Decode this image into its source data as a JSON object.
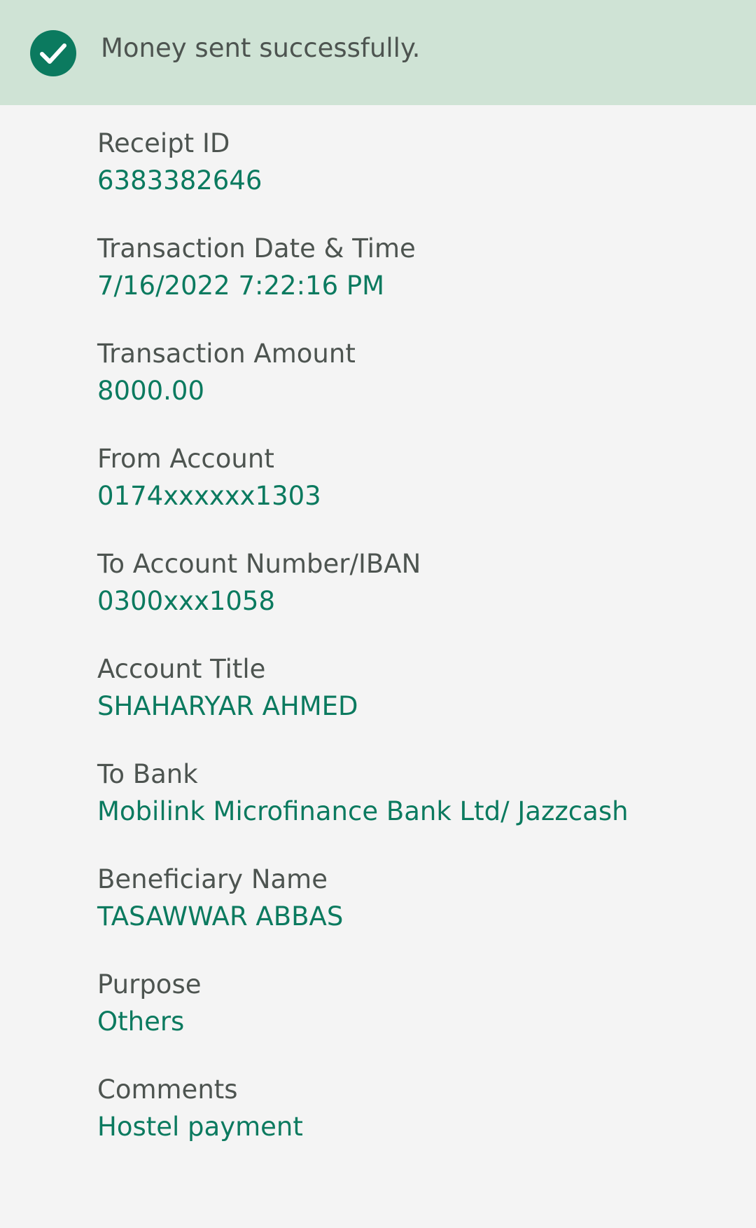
{
  "banner": {
    "icon": "check-circle-icon",
    "message": "Money sent successfully.",
    "background_color": "#cfe3d5",
    "icon_color": "#0b7a5f"
  },
  "fields": [
    {
      "label": "Receipt ID",
      "value": "6383382646"
    },
    {
      "label": "Transaction Date & Time",
      "value": "7/16/2022 7:22:16 PM"
    },
    {
      "label": "Transaction Amount",
      "value": "8000.00"
    },
    {
      "label": "From Account",
      "value": "0174xxxxxx1303"
    },
    {
      "label": "To Account Number/IBAN",
      "value": "0300xxx1058"
    },
    {
      "label": "Account Title",
      "value": "SHAHARYAR AHMED"
    },
    {
      "label": "To Bank",
      "value": "Mobilink Microfinance Bank Ltd/ Jazzcash"
    },
    {
      "label": "Beneficiary Name",
      "value": "TASAWWAR ABBAS"
    },
    {
      "label": "Purpose",
      "value": "Others"
    },
    {
      "label": "Comments",
      "value": "Hostel payment"
    }
  ],
  "colors": {
    "label": "#4d5450",
    "value": "#0b7a5f",
    "page_background": "#f4f4f4"
  }
}
